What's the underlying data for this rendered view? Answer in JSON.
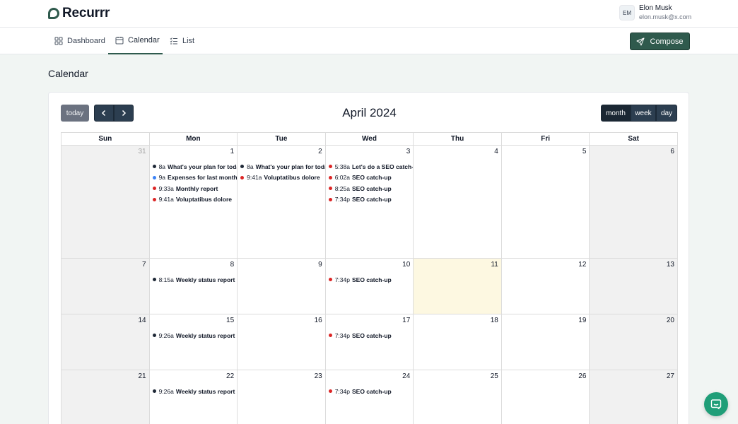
{
  "app": {
    "name": "Recurrr",
    "brand_color": "#2f5a4d"
  },
  "user": {
    "initials": "EM",
    "name": "Elon Musk",
    "email": "elon.musk@x.com"
  },
  "nav": {
    "tabs": [
      {
        "label": "Dashboard",
        "icon": "dashboard-grid-icon",
        "active": false
      },
      {
        "label": "Calendar",
        "icon": "calendar-icon",
        "active": true
      },
      {
        "label": "List",
        "icon": "checklist-icon",
        "active": false
      }
    ],
    "compose_label": "Compose"
  },
  "page": {
    "title": "Calendar"
  },
  "calendar": {
    "title": "April 2024",
    "today_label": "today",
    "views": [
      {
        "label": "month",
        "active": true
      },
      {
        "label": "week",
        "active": false
      },
      {
        "label": "day",
        "active": false
      }
    ],
    "weekdays": [
      "Sun",
      "Mon",
      "Tue",
      "Wed",
      "Thu",
      "Fri",
      "Sat"
    ],
    "weeks": [
      [
        {
          "day": "31",
          "other": true,
          "events": []
        },
        {
          "day": "1",
          "events": [
            {
              "time": "8a",
              "title": "What's your plan for today?",
              "color": "#1f2937"
            },
            {
              "time": "9a",
              "title": "Expenses for last month",
              "color": "#3b82f6"
            },
            {
              "time": "9:33a",
              "title": "Monthly report",
              "color": "#dc2626"
            },
            {
              "time": "9:41a",
              "title": "Voluptatibus dolore",
              "color": "#dc2626"
            }
          ]
        },
        {
          "day": "2",
          "events": [
            {
              "time": "8a",
              "title": "What's your plan for today?",
              "color": "#1f2937"
            },
            {
              "time": "9:41a",
              "title": "Voluptatibus dolore",
              "color": "#dc2626"
            }
          ]
        },
        {
          "day": "3",
          "events": [
            {
              "time": "5:38a",
              "title": "Let's do a SEO catch-up",
              "color": "#dc2626"
            },
            {
              "time": "6:02a",
              "title": "SEO catch-up",
              "color": "#dc2626"
            },
            {
              "time": "8:25a",
              "title": "SEO catch-up",
              "color": "#dc2626"
            },
            {
              "time": "7:34p",
              "title": "SEO catch-up",
              "color": "#dc2626"
            }
          ]
        },
        {
          "day": "4",
          "events": []
        },
        {
          "day": "5",
          "events": []
        },
        {
          "day": "6",
          "events": []
        }
      ],
      [
        {
          "day": "7",
          "events": []
        },
        {
          "day": "8",
          "events": [
            {
              "time": "8:15a",
              "title": "Weekly status report",
              "color": "#1f2937"
            }
          ]
        },
        {
          "day": "9",
          "events": []
        },
        {
          "day": "10",
          "events": [
            {
              "time": "7:34p",
              "title": "SEO catch-up",
              "color": "#dc2626"
            }
          ]
        },
        {
          "day": "11",
          "today": true,
          "events": []
        },
        {
          "day": "12",
          "events": []
        },
        {
          "day": "13",
          "events": []
        }
      ],
      [
        {
          "day": "14",
          "events": []
        },
        {
          "day": "15",
          "events": [
            {
              "time": "9:26a",
              "title": "Weekly status report",
              "color": "#1f2937"
            }
          ]
        },
        {
          "day": "16",
          "events": []
        },
        {
          "day": "17",
          "events": [
            {
              "time": "7:34p",
              "title": "SEO catch-up",
              "color": "#dc2626"
            }
          ]
        },
        {
          "day": "18",
          "events": []
        },
        {
          "day": "19",
          "events": []
        },
        {
          "day": "20",
          "events": []
        }
      ],
      [
        {
          "day": "21",
          "events": []
        },
        {
          "day": "22",
          "events": [
            {
              "time": "9:26a",
              "title": "Weekly status report",
              "color": "#1f2937"
            }
          ]
        },
        {
          "day": "23",
          "events": []
        },
        {
          "day": "24",
          "events": [
            {
              "time": "7:34p",
              "title": "SEO catch-up",
              "color": "#dc2626"
            }
          ]
        },
        {
          "day": "25",
          "events": []
        },
        {
          "day": "26",
          "events": []
        },
        {
          "day": "27",
          "events": []
        }
      ]
    ]
  },
  "chat": {
    "icon": "chat-bubble-icon"
  }
}
